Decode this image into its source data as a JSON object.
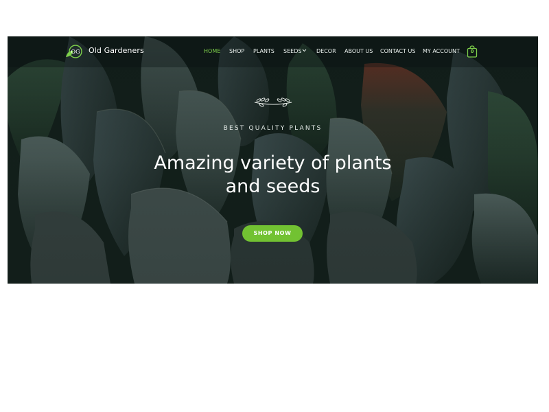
{
  "site": {
    "name": "Old Gardeners",
    "logo_icon": "leaf-og-logo"
  },
  "nav": {
    "items": [
      {
        "label": "HOME",
        "active": true
      },
      {
        "label": "SHOP"
      },
      {
        "label": "PLANTS"
      },
      {
        "label": "SEEDS",
        "has_dropdown": true
      },
      {
        "label": "DECOR"
      },
      {
        "label": "ABOUT US"
      },
      {
        "label": "CONTACT US"
      },
      {
        "label": "MY ACCOUNT"
      }
    ],
    "cart_count": "0",
    "cart_icon": "shopping-bag-icon",
    "dropdown_icon": "chevron-down-icon"
  },
  "hero": {
    "ornament_icon": "laurel-branch-icon",
    "kicker": "BEST QUALITY PLANTS",
    "headline_line1": "Amazing variety of plants",
    "headline_line2": "and seeds",
    "button_label": "SHOP NOW"
  },
  "colors": {
    "accent": "#72c232",
    "active_nav": "#7ed04b",
    "hero_dark": "#1a2a24",
    "page_bg": "#ffffff"
  }
}
